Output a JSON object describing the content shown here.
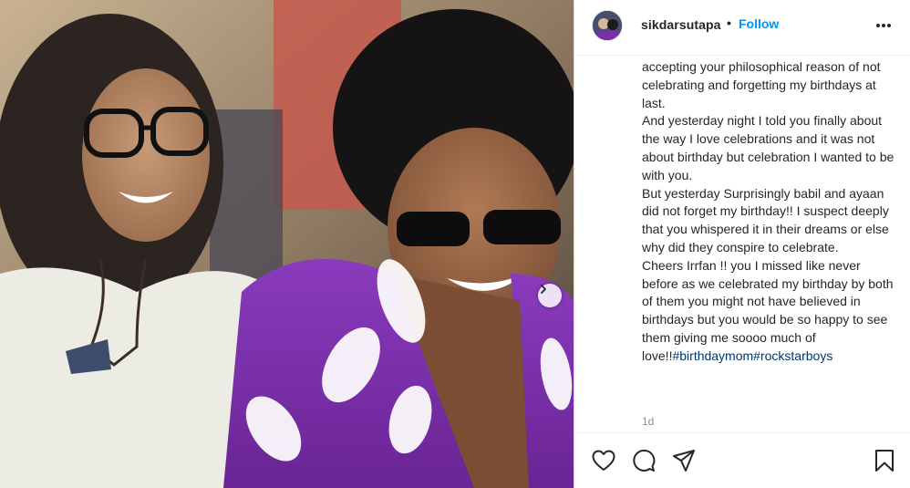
{
  "post": {
    "username": "sikdarsutapa",
    "separator": "•",
    "follow_label": "Follow",
    "more_icon": "more-options-icon",
    "caption_lines": [
      "accepting your philosophical reason of not celebrating and forgetting my birthdays at last.",
      "And yesterday night I told you finally about the way I love celebrations and it was not about birthday but celebration I wanted to be with you.",
      "But yesterday Surprisingly babil and ayaan did not forget my birthday!! I suspect deeply that you whispered it in their dreams or else why did they conspire to celebrate.",
      "Cheers Irrfan !! you I missed like never before as we celebrated my birthday by both of them you might not have believed in birthdays but you would be so happy to see them giving me soooo much of"
    ],
    "caption_last_prefix": "love!!",
    "hashtags": [
      "#birthdaymom",
      "#rockstarboys"
    ],
    "age": "1d"
  },
  "photo": {
    "next_icon": "chevron-right-icon"
  },
  "actions": {
    "like_icon": "heart-icon",
    "comment_icon": "comment-icon",
    "share_icon": "share-icon",
    "save_icon": "bookmark-icon"
  },
  "colors": {
    "follow": "#0095f6",
    "hashtag": "#00376b",
    "muted": "#8e8e8e",
    "shirt": "#7b2fa8"
  }
}
